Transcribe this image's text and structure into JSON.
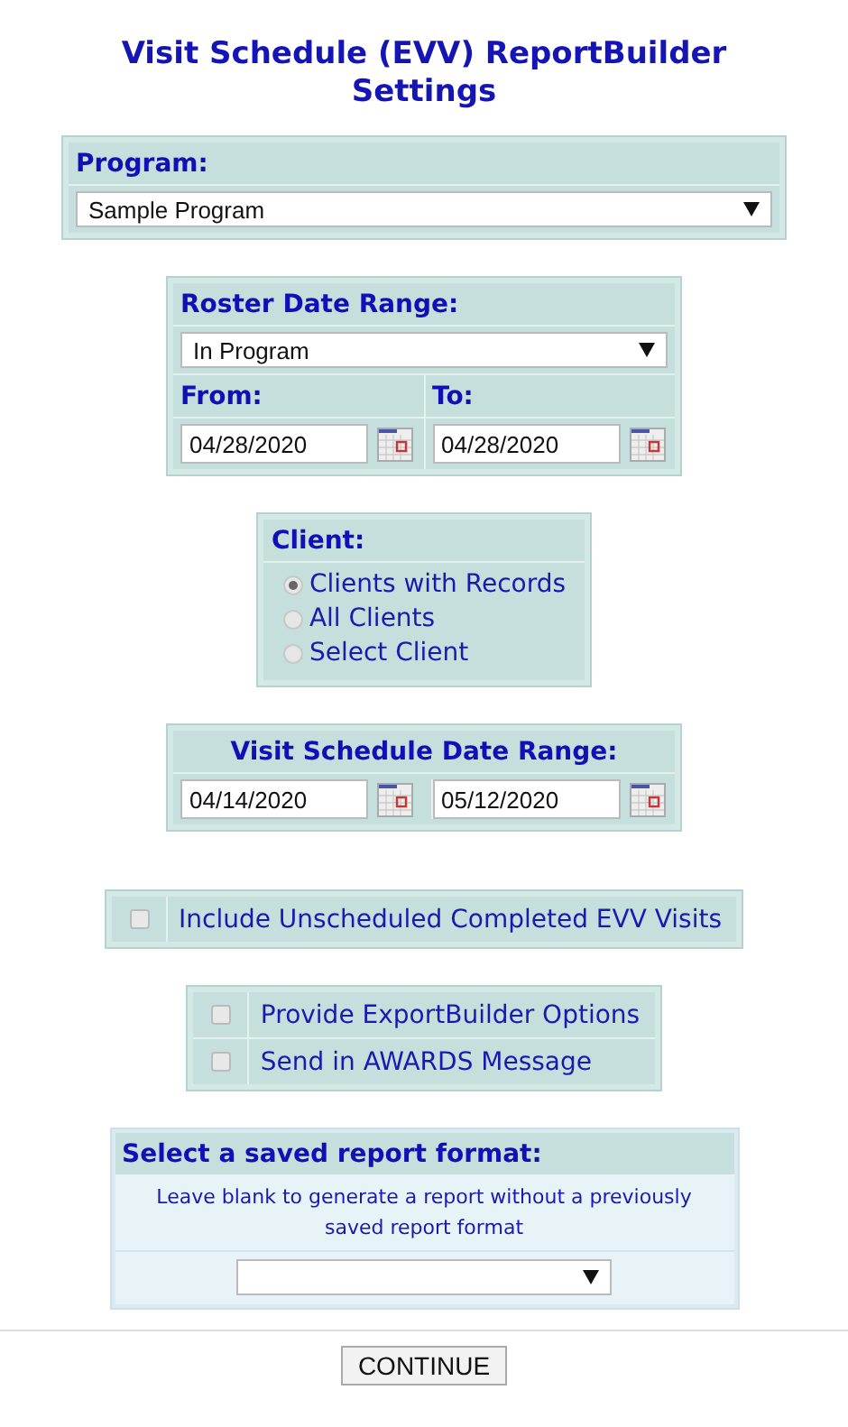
{
  "title": "Visit Schedule (EVV) ReportBuilder Settings",
  "program": {
    "label": "Program:",
    "value": "Sample Program"
  },
  "roster": {
    "label": "Roster Date Range:",
    "value": "In Program",
    "from_label": "From:",
    "from": "04/28/2020",
    "to_label": "To:",
    "to": "04/28/2020"
  },
  "client": {
    "label": "Client:",
    "options": [
      {
        "label": "Clients with Records",
        "selected": true
      },
      {
        "label": "All Clients",
        "selected": false
      },
      {
        "label": "Select Client",
        "selected": false
      }
    ]
  },
  "visit_range": {
    "label": "Visit Schedule Date Range:",
    "from": "04/14/2020",
    "to": "05/12/2020"
  },
  "checkbox_groups": [
    [
      {
        "label": "Include Unscheduled Completed EVV Visits",
        "checked": false
      }
    ],
    [
      {
        "label": "Provide ExportBuilder Options",
        "checked": false
      },
      {
        "label": "Send in AWARDS Message",
        "checked": false
      }
    ]
  ],
  "saved_format": {
    "label": "Select a saved report format:",
    "hint": "Leave blank to generate a report without a previously saved report format"
  },
  "continue_button": "CONTINUE"
}
